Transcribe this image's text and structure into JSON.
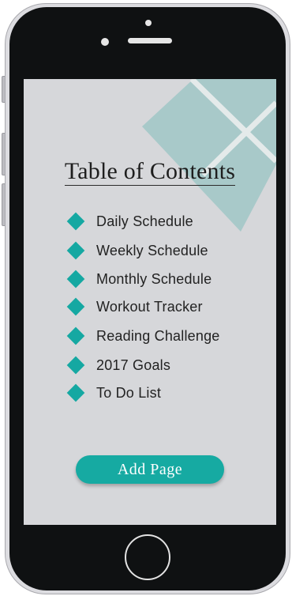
{
  "screen": {
    "title": "Table of Contents",
    "toc_items": [
      {
        "label": "Daily Schedule",
        "icon": "diamond-icon"
      },
      {
        "label": "Weekly Schedule",
        "icon": "diamond-icon"
      },
      {
        "label": "Monthly Schedule",
        "icon": "diamond-icon"
      },
      {
        "label": "Workout Tracker",
        "icon": "diamond-icon"
      },
      {
        "label": "Reading Challenge",
        "icon": "diamond-icon"
      },
      {
        "label": "2017 Goals",
        "icon": "diamond-icon"
      },
      {
        "label": "To Do List",
        "icon": "diamond-icon"
      }
    ],
    "add_button_label": "Add Page"
  },
  "colors": {
    "accent": "#15a8a2",
    "screen_background": "#d6d7da",
    "decoration": "#a8c9c9",
    "phone_frame": "#0f1112"
  }
}
